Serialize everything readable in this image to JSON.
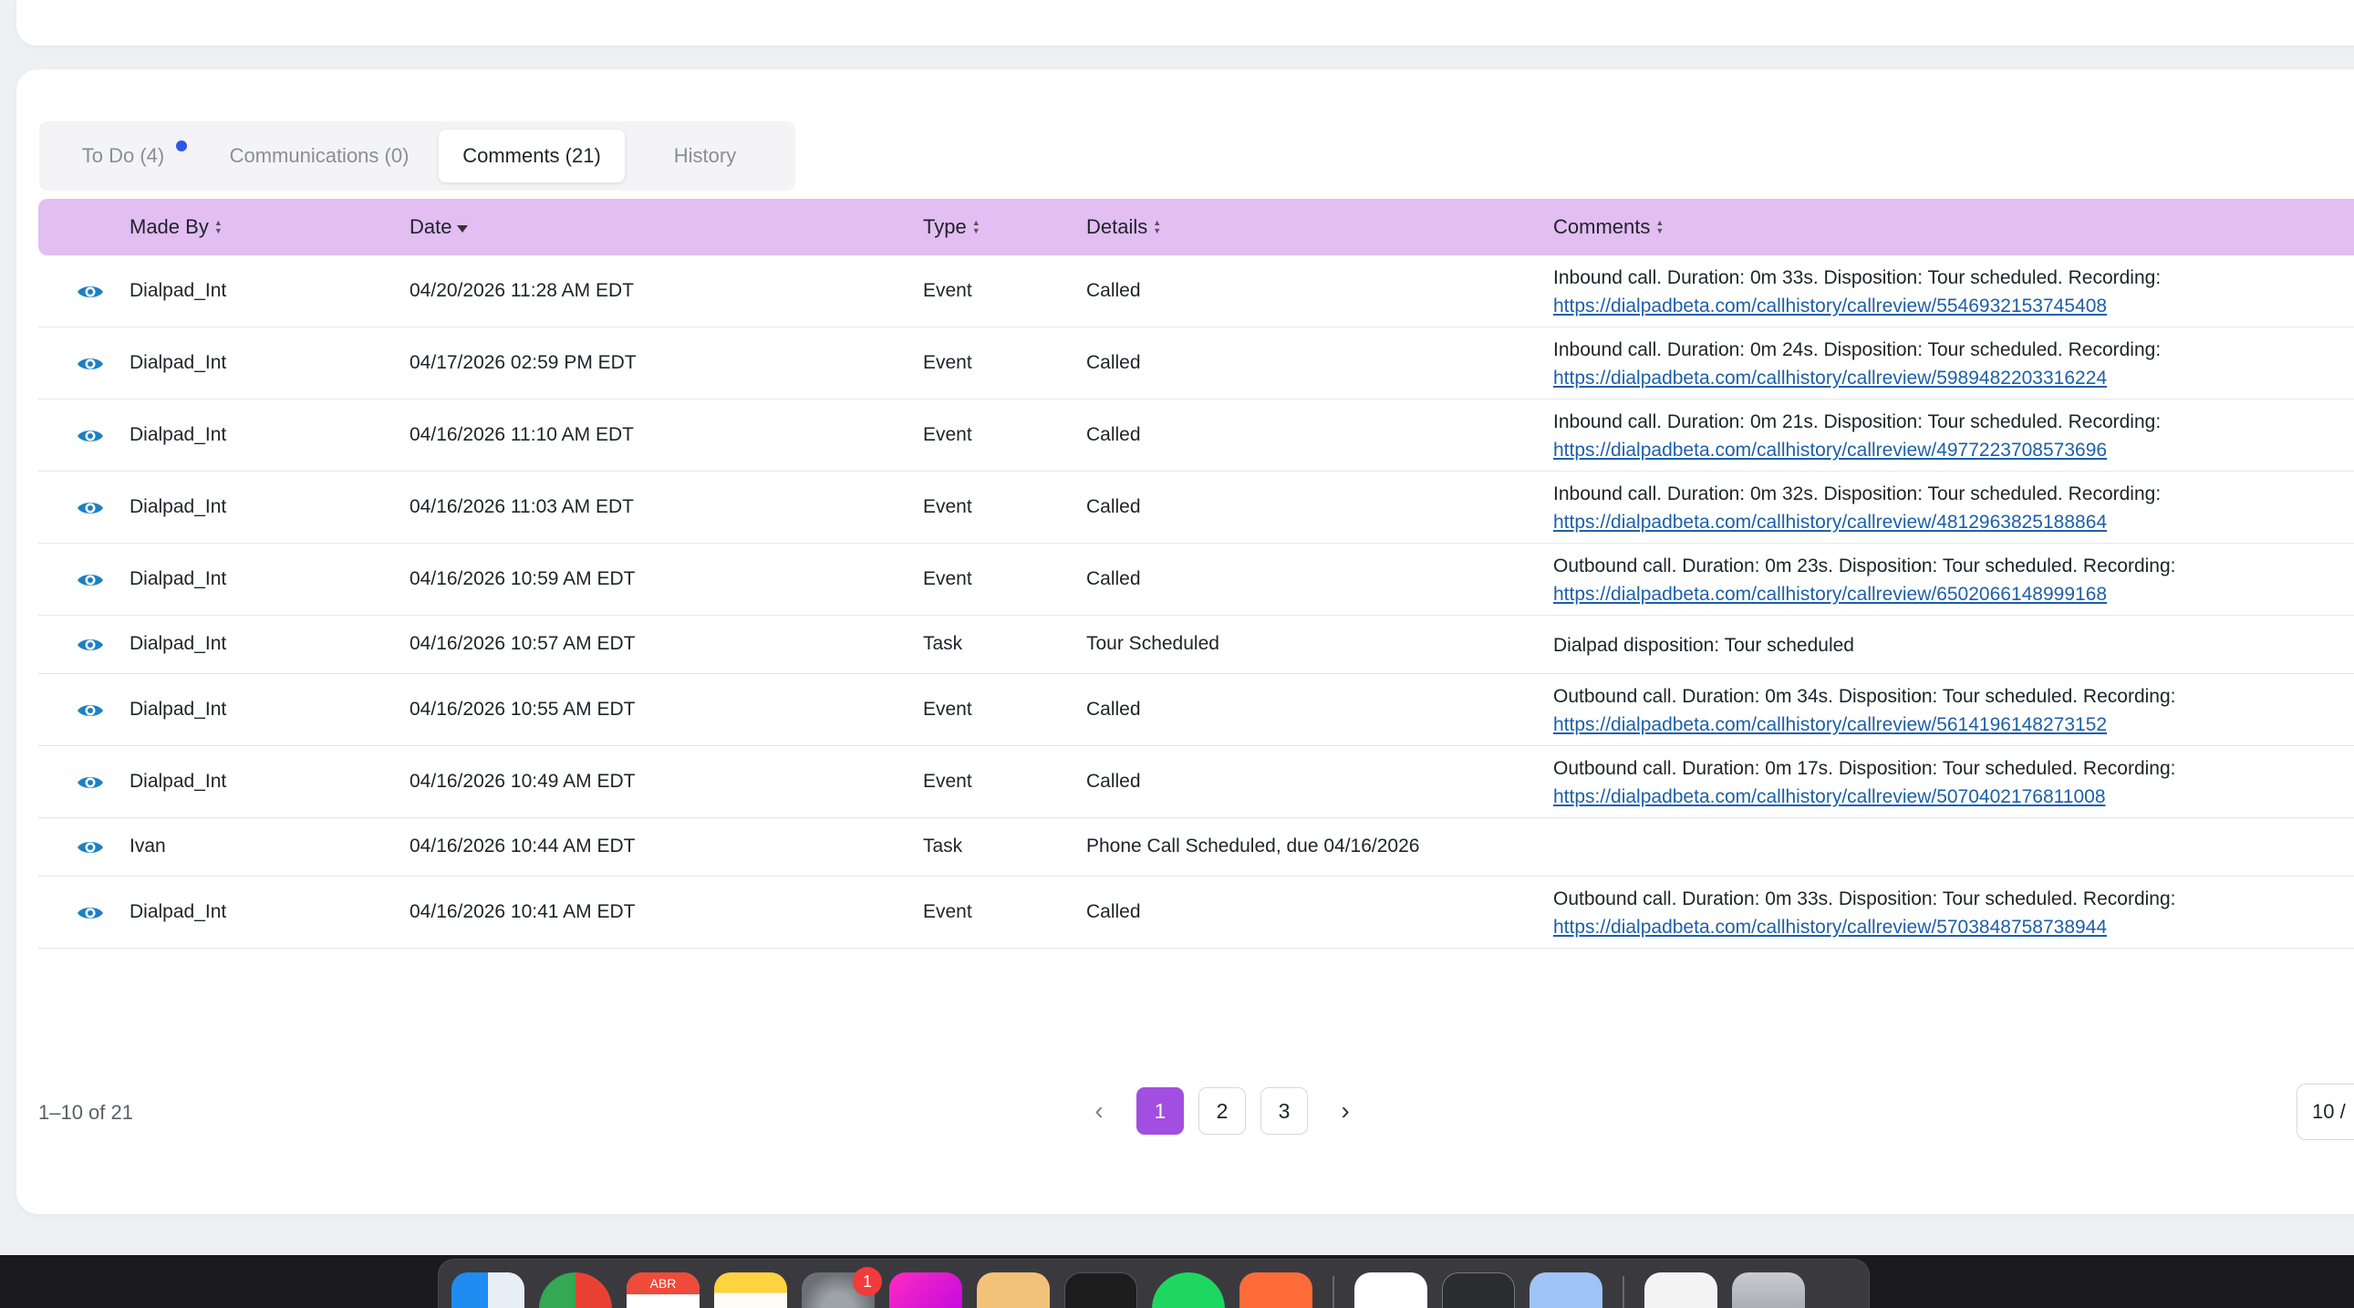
{
  "tabs": [
    {
      "label": "To Do (4)",
      "has_dot": true
    },
    {
      "label": "Communications (0)"
    },
    {
      "label": "Comments (21)",
      "active": true
    },
    {
      "label": "History"
    }
  ],
  "table": {
    "headers": {
      "made_by": "Made By",
      "date": "Date",
      "type": "Type",
      "details": "Details",
      "comments": "Comments"
    },
    "rows": [
      {
        "made_by": "Dialpad_Int",
        "date": "04/20/2026 11:28 AM EDT",
        "type": "Event",
        "details": "Called",
        "comment": "Inbound call. Duration: 0m 33s. Disposition: Tour scheduled. Recording:",
        "link": "https://dialpadbeta.com/callhistory/callreview/5546932153745408"
      },
      {
        "made_by": "Dialpad_Int",
        "date": "04/17/2026 02:59 PM EDT",
        "type": "Event",
        "details": "Called",
        "comment": "Inbound call. Duration: 0m 24s. Disposition: Tour scheduled. Recording:",
        "link": "https://dialpadbeta.com/callhistory/callreview/5989482203316224"
      },
      {
        "made_by": "Dialpad_Int",
        "date": "04/16/2026 11:10 AM EDT",
        "type": "Event",
        "details": "Called",
        "comment": "Inbound call. Duration: 0m 21s. Disposition: Tour scheduled. Recording:",
        "link": "https://dialpadbeta.com/callhistory/callreview/4977223708573696"
      },
      {
        "made_by": "Dialpad_Int",
        "date": "04/16/2026 11:03 AM EDT",
        "type": "Event",
        "details": "Called",
        "comment": "Inbound call. Duration: 0m 32s. Disposition: Tour scheduled. Recording:",
        "link": "https://dialpadbeta.com/callhistory/callreview/4812963825188864"
      },
      {
        "made_by": "Dialpad_Int",
        "date": "04/16/2026 10:59 AM EDT",
        "type": "Event",
        "details": "Called",
        "comment": "Outbound call. Duration: 0m 23s. Disposition: Tour scheduled. Recording:",
        "link": "https://dialpadbeta.com/callhistory/callreview/6502066148999168"
      },
      {
        "made_by": "Dialpad_Int",
        "date": "04/16/2026 10:57 AM EDT",
        "type": "Task",
        "details": "Tour Scheduled",
        "comment": "Dialpad disposition: Tour scheduled",
        "link": ""
      },
      {
        "made_by": "Dialpad_Int",
        "date": "04/16/2026 10:55 AM EDT",
        "type": "Event",
        "details": "Called",
        "comment": "Outbound call. Duration: 0m 34s. Disposition: Tour scheduled. Recording:",
        "link": "https://dialpadbeta.com/callhistory/callreview/5614196148273152"
      },
      {
        "made_by": "Dialpad_Int",
        "date": "04/16/2026 10:49 AM EDT",
        "type": "Event",
        "details": "Called",
        "comment": "Outbound call. Duration: 0m 17s. Disposition: Tour scheduled. Recording:",
        "link": "https://dialpadbeta.com/callhistory/callreview/5070402176811008"
      },
      {
        "made_by": "Ivan",
        "date": "04/16/2026 10:44 AM EDT",
        "type": "Task",
        "details": "Phone Call Scheduled, due 04/16/2026",
        "comment": "",
        "link": ""
      },
      {
        "made_by": "Dialpad_Int",
        "date": "04/16/2026 10:41 AM EDT",
        "type": "Event",
        "details": "Called",
        "comment": "Outbound call. Duration: 0m 33s. Disposition: Tour scheduled. Recording:",
        "link": "https://dialpadbeta.com/callhistory/callreview/5703848758738944"
      }
    ]
  },
  "pagination": {
    "summary": "1–10 of 21",
    "pages": [
      "1",
      "2",
      "3"
    ],
    "current": "1",
    "page_size": "10 /"
  },
  "dock": {
    "calendar_month": "ABR",
    "settings_badge": "1",
    "icons": [
      "finder-icon",
      "chrome-icon",
      "calendar-icon",
      "notes-icon",
      "system-settings-icon",
      "adobe-illustrator-icon",
      "preview-app-icon",
      "terminal-icon",
      "spotify-icon",
      "postman-icon",
      "vscode-icon",
      "activity-monitor-icon",
      "folder-icon",
      "documents-stack-icon",
      "trash-icon"
    ]
  },
  "colors": {
    "header_bg": "#e2bef2",
    "accent": "#a24ee0",
    "link": "#1d5fa8",
    "eye": "#1f7fc4"
  }
}
